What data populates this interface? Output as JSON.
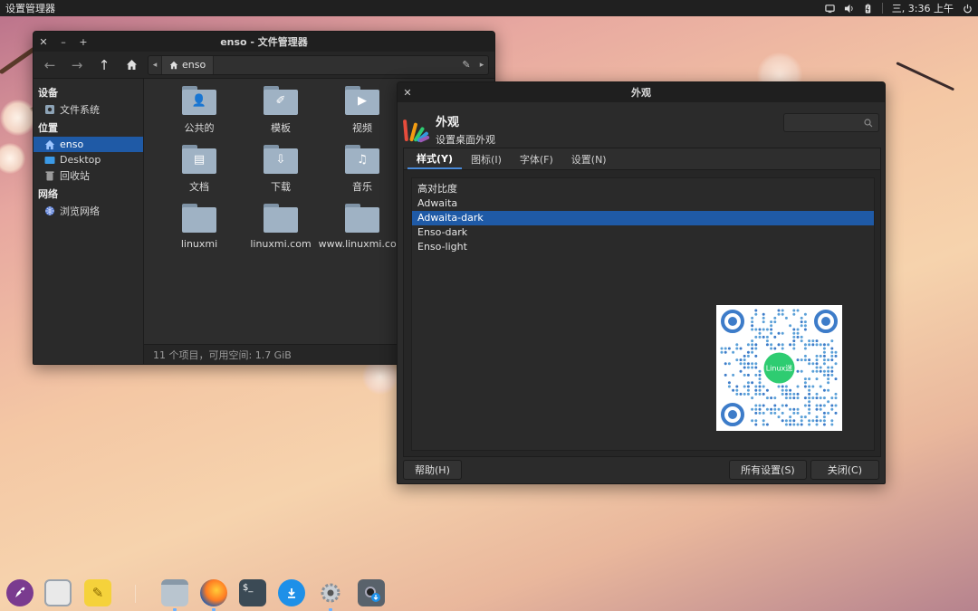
{
  "top_panel": {
    "app_name": "设置管理器",
    "clock": "三, 3:36 上午"
  },
  "file_manager": {
    "title": "enso - 文件管理器",
    "path_crumb": "enso",
    "sidebar": {
      "section_devices": "设备",
      "filesystem": "文件系统",
      "section_places": "位置",
      "home": "enso",
      "desktop": "Desktop",
      "trash": "回收站",
      "section_network": "网络",
      "browse_network": "浏览网络"
    },
    "items": [
      {
        "label": "公共的",
        "glyph": "person-icon"
      },
      {
        "label": "模板",
        "glyph": "compass-icon"
      },
      {
        "label": "视频",
        "glyph": "video-icon"
      },
      {
        "label": "文档",
        "glyph": "document-icon"
      },
      {
        "label": "下载",
        "glyph": "download-icon"
      },
      {
        "label": "音乐",
        "glyph": "music-icon"
      },
      {
        "label": "linuxmi",
        "glyph": ""
      },
      {
        "label": "linuxmi.com",
        "glyph": ""
      },
      {
        "label": "www.linuxmi.com",
        "glyph": ""
      }
    ],
    "status": "11 个项目，可用空间: 1.7 GiB"
  },
  "appearance": {
    "window_title": "外观",
    "heading": "外观",
    "subheading": "设置桌面外观",
    "tabs": [
      "样式(Y)",
      "图标(I)",
      "字体(F)",
      "设置(N)"
    ],
    "themes": [
      "高对比度",
      "Adwaita",
      "Adwaita-dark",
      "Enso-dark",
      "Enso-light"
    ],
    "selected_theme": "Adwaita-dark",
    "qr_badge": "Linux迷",
    "help_button": "帮助(H)",
    "all_settings_button": "所有设置(S)",
    "close_button": "关闭(C)"
  },
  "colors": {
    "selection": "#1f5aa6",
    "folder": "#9fb2c4",
    "panel": "#202020",
    "window_bg": "#2b2b2b"
  },
  "dock_icons": [
    "rocket-icon",
    "window-icon",
    "notes-icon",
    "file-manager-icon",
    "firefox-icon",
    "terminal-icon",
    "download-icon",
    "settings-icon",
    "disk-download-icon"
  ]
}
